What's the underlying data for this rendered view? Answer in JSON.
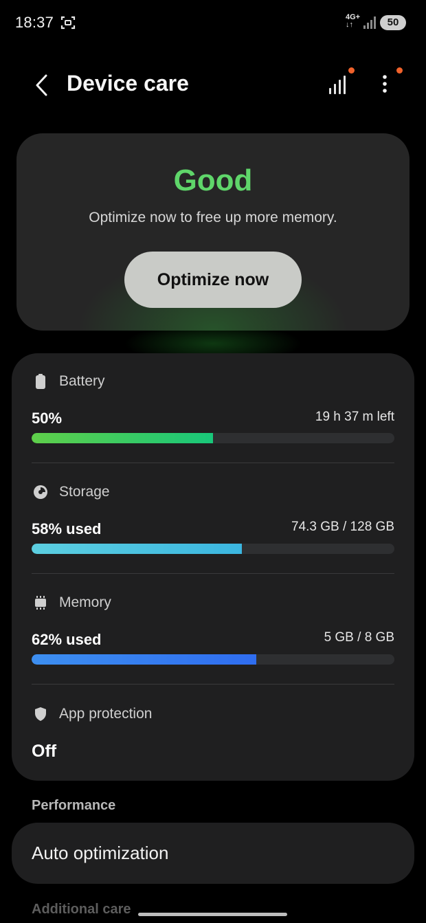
{
  "status_bar": {
    "time": "18:37",
    "network": "4G+",
    "battery_level": "50"
  },
  "header": {
    "title": "Device care"
  },
  "status_card": {
    "status": "Good",
    "message": "Optimize now to free up more memory.",
    "button_label": "Optimize now",
    "status_color": "#5fd66a"
  },
  "metrics": {
    "battery": {
      "label": "Battery",
      "value": "50%",
      "detail": "19 h 37 m left",
      "fill_fraction": 0.5,
      "color_start": "#5fcf4a",
      "color_end": "#18c77a",
      "icon": "battery-icon"
    },
    "storage": {
      "label": "Storage",
      "value": "58% used",
      "detail": "74.3 GB / 128 GB",
      "fill_fraction": 0.58,
      "color_start": "#5ccfe0",
      "color_end": "#3bb6e0",
      "icon": "pie-chart-icon"
    },
    "memory": {
      "label": "Memory",
      "value": "62% used",
      "detail": "5 GB / 8 GB",
      "fill_fraction": 0.62,
      "color_start": "#3d8ff0",
      "color_end": "#2f6df0",
      "icon": "chip-icon"
    },
    "app_protection": {
      "label": "App protection",
      "value": "Off",
      "icon": "shield-icon"
    }
  },
  "performance": {
    "section_label": "Performance",
    "auto_optimization_label": "Auto optimization"
  },
  "additional_care": {
    "section_label": "Additional care"
  }
}
